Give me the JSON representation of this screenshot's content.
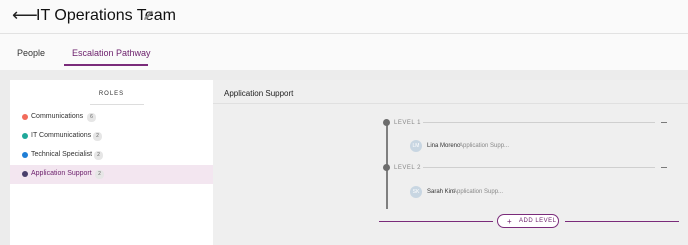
{
  "header": {
    "title": "IT Operations Team",
    "back_icon": "⟵",
    "edit_icon": "pencil-icon"
  },
  "tabs": [
    {
      "label": "People",
      "active": false
    },
    {
      "label": "Escalation Pathway",
      "active": true
    }
  ],
  "roles": {
    "title": "ROLES",
    "items": [
      {
        "label": "Communications",
        "count": "6",
        "color": "#f26b5b",
        "selected": false
      },
      {
        "label": "IT Communications",
        "count": "2",
        "color": "#1fa89a",
        "selected": false
      },
      {
        "label": "Technical Specialist",
        "count": "2",
        "color": "#1f7ed6",
        "selected": false
      },
      {
        "label": "Application Support",
        "count": "2",
        "color": "#4a3f6b",
        "selected": true
      }
    ]
  },
  "main": {
    "title": "Application Support",
    "levels": [
      {
        "label": "LEVEL 1",
        "member": {
          "initials": "LM",
          "name": "Lina Moreno",
          "role": "Application Supp..."
        }
      },
      {
        "label": "LEVEL 2",
        "member": {
          "initials": "SK",
          "name": "Sarah Kim",
          "role": "Application Supp..."
        }
      }
    ],
    "add_button": {
      "label": "ADD LEVEL",
      "icon": "+"
    }
  },
  "colors": {
    "accent": "#7a2b7a",
    "selected_row": "#f3e6f0"
  }
}
